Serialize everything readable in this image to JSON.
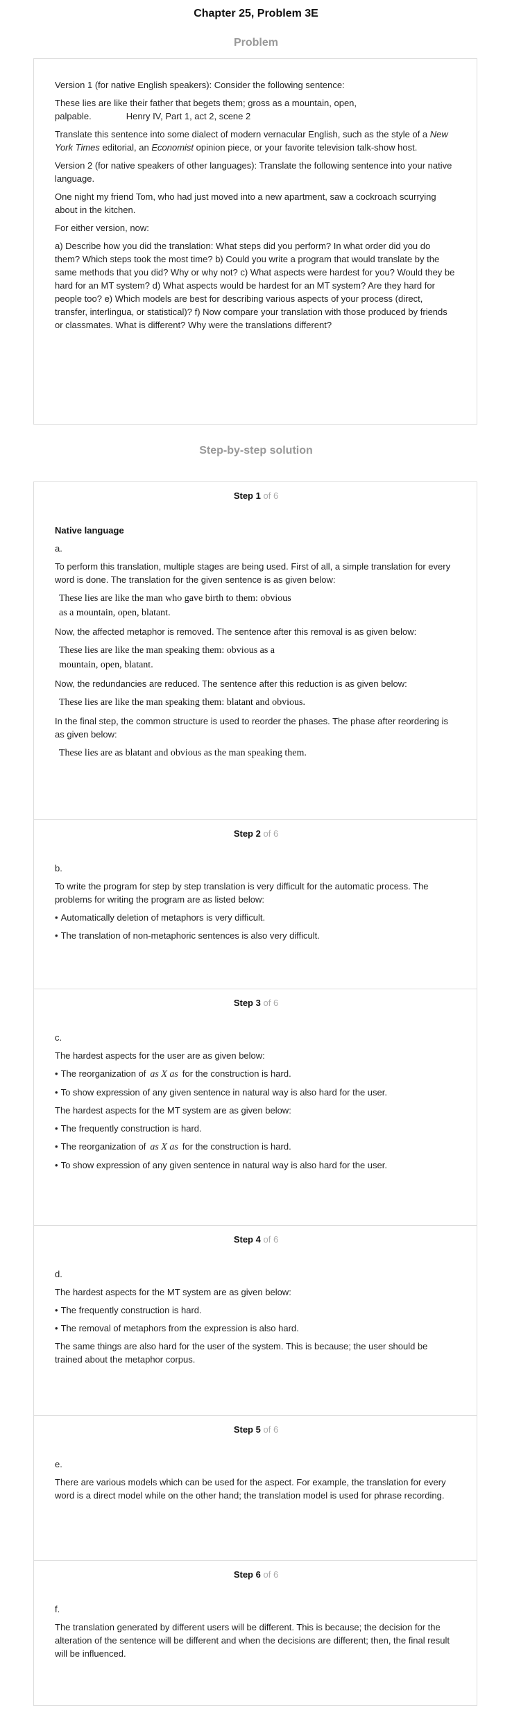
{
  "page_title": "Chapter 25, Problem 3E",
  "problem_heading": "Problem",
  "problem": {
    "version1": "Version 1 (for native English speakers): Consider the following sentence:",
    "quote_line1": "These lies are like their father that begets them; gross as a mountain, open,",
    "quote_line2": "palpable.",
    "quote_source": "Henry IV, Part 1, act 2, scene 2",
    "translate_pre": "Translate this sentence into some dialect of modern vernacular English, such as the style of a ",
    "translate_nyt": "New York Times",
    "translate_mid": " editorial, an ",
    "translate_economist": "Economist",
    "translate_post": " opinion piece, or your favorite television talk-show host.",
    "version2": "Version 2 (for native speakers of other languages): Translate the following sentence into your native language.",
    "tom_sentence": "One night my friend Tom, who had just moved into a new apartment, saw a cockroach scurrying about in the kitchen.",
    "either": "For either version, now:",
    "questions": "a) Describe how you did the translation: What steps did you perform? In what order did you do them? Which steps took the most time? b) Could you write a program that would translate by the same methods that you did? Why or why not? c) What aspects were hardest for you? Would they be hard for an MT system? d) What aspects would be hardest for an MT system? Are they hard for people too? e) Which models are best for describing various aspects of your process (direct, transfer, interlingua, or statistical)? f) Now compare your translation with those produced by friends or classmates. What is different? Why were the translations different?"
  },
  "solution_heading": "Step-by-step solution",
  "steps": [
    {
      "word": "Step",
      "num": "1",
      "of": "of 6",
      "subheading": "Native language",
      "letter": "a.",
      "p1": "To perform this translation, multiple stages are being used. First of all, a simple translation for every word is done. The translation for the given sentence is as given below:",
      "m1a": "These lies are like the man who gave birth to them: obvious",
      "m1b": "as a mountain, open, blatant.",
      "p2": "Now, the affected metaphor is removed. The sentence after this removal is as given below:",
      "m2a": "These lies are like the man speaking them: obvious as a",
      "m2b": "mountain, open, blatant.",
      "p3": "Now, the redundancies are reduced. The sentence after this reduction is as given below:",
      "m3": "These lies are like the man speaking them: blatant and obvious.",
      "p4": "In the final step, the common structure is used to reorder the phases. The phase after reordering is as given below:",
      "m4": "These lies are as blatant and obvious as the man speaking them."
    },
    {
      "word": "Step",
      "num": "2",
      "of": "of 6",
      "letter": "b.",
      "p1": "To write the program for step by step translation is very difficult for the automatic process. The problems for writing the program are as listed below:",
      "b1": "Automatically deletion of metaphors is very difficult.",
      "b2": "The translation of non-metaphoric sentences is also very difficult."
    },
    {
      "word": "Step",
      "num": "3",
      "of": "of 6",
      "letter": "c.",
      "p1": "The hardest aspects for the user are as given below:",
      "b1_pre": "The reorganization of",
      "b1_math": "as X as",
      "b1_post": "for the construction is hard.",
      "b2": "To show expression of any given sentence in natural way is also hard for the user.",
      "p2": "The hardest aspects for the MT system are as given below:",
      "b3": "The frequently construction is hard.",
      "b4_pre": "The reorganization of",
      "b4_math": "as X as",
      "b4_post": "for the construction is hard.",
      "b5": "To show expression of any given sentence in natural way is also hard for the user."
    },
    {
      "word": "Step",
      "num": "4",
      "of": "of 6",
      "letter": "d.",
      "p1": "The hardest aspects for the MT system are as given below:",
      "b1": "The frequently construction is hard.",
      "b2": "The removal of metaphors from the expression is also hard.",
      "p2": "The same things are also hard for the user of the system. This is because; the user should be trained about the metaphor corpus."
    },
    {
      "word": "Step",
      "num": "5",
      "of": "of 6",
      "letter": "e.",
      "p1": "There are various models which can be used for the aspect. For example, the translation for every word is a direct model while on the other hand; the translation model is used for phrase recording."
    },
    {
      "word": "Step",
      "num": "6",
      "of": "of 6",
      "letter": "f.",
      "p1": "The translation generated by different users will be different. This is because; the decision for the alteration of the sentence will be different and when the decisions are different; then, the final result will be influenced."
    }
  ]
}
